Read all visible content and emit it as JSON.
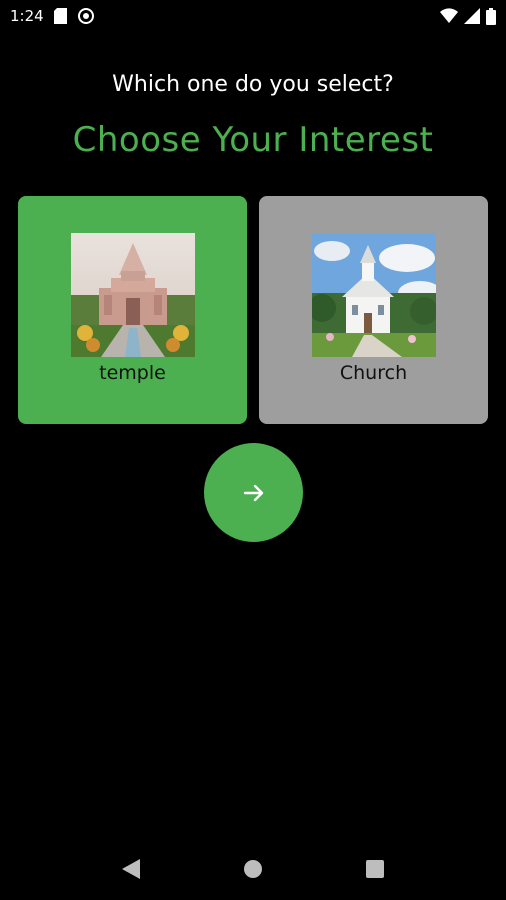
{
  "status_bar": {
    "time": "1:24",
    "icons": [
      "sd-card-icon",
      "sync-icon",
      "wifi-icon",
      "cellular-signal-icon",
      "battery-icon"
    ]
  },
  "header": {
    "subtitle": "Which one do you select?",
    "title": "Choose Your Interest"
  },
  "options": [
    {
      "label": "temple",
      "selected": true,
      "image": "temple-photo"
    },
    {
      "label": "Church",
      "selected": false,
      "image": "church-photo"
    }
  ],
  "next_button": {
    "icon": "arrow-right-icon"
  },
  "nav_bar": {
    "icons": [
      "back-icon",
      "home-icon",
      "recents-icon"
    ]
  },
  "colors": {
    "accent": "#4caf50",
    "unselected": "#9e9e9e",
    "background": "#000000"
  }
}
